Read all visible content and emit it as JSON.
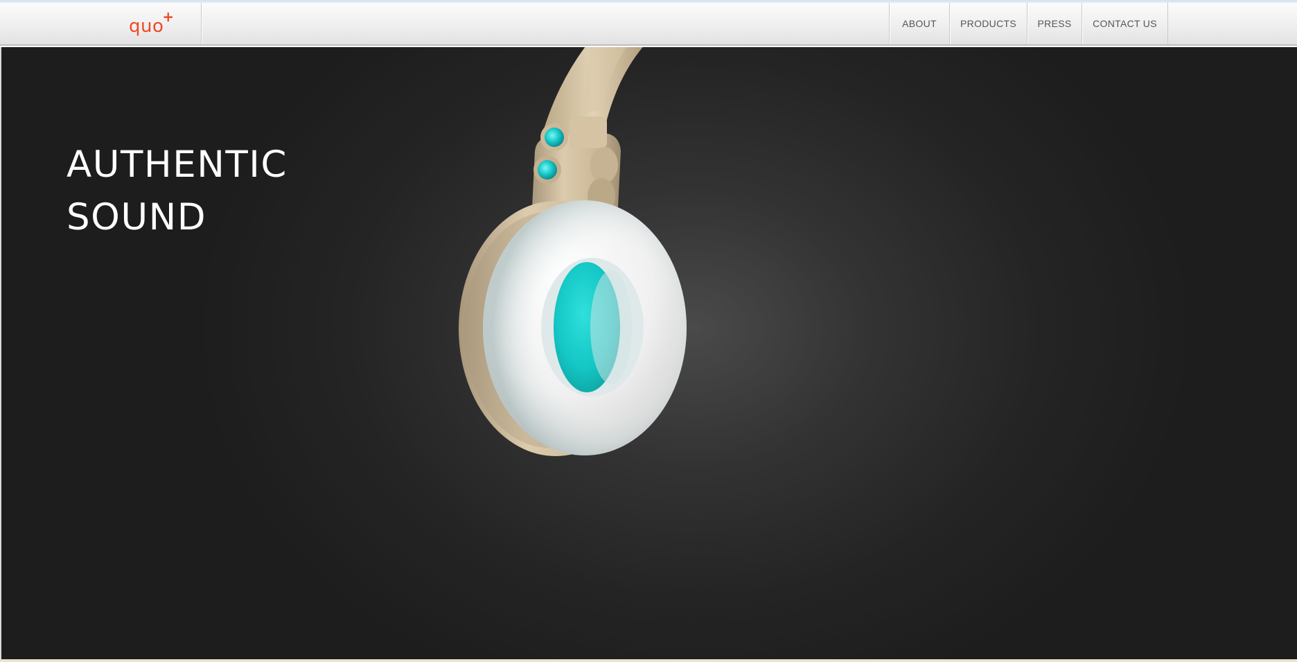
{
  "brand": {
    "logo_text": "QUO",
    "logo_mark": "+",
    "accent_color": "#ee4a23"
  },
  "nav": {
    "items": [
      {
        "label": "ABOUT"
      },
      {
        "label": "PRODUCTS"
      },
      {
        "label": "PRESS"
      },
      {
        "label": "CONTACT US"
      }
    ]
  },
  "hero": {
    "headline_line1": "AUTHENTIC",
    "headline_line2": "SOUND",
    "background_color": "#242424",
    "product_colors": {
      "frame": "#cdb99a",
      "cushion": "#f2f2f2",
      "accent": "#1ecfcf"
    }
  }
}
